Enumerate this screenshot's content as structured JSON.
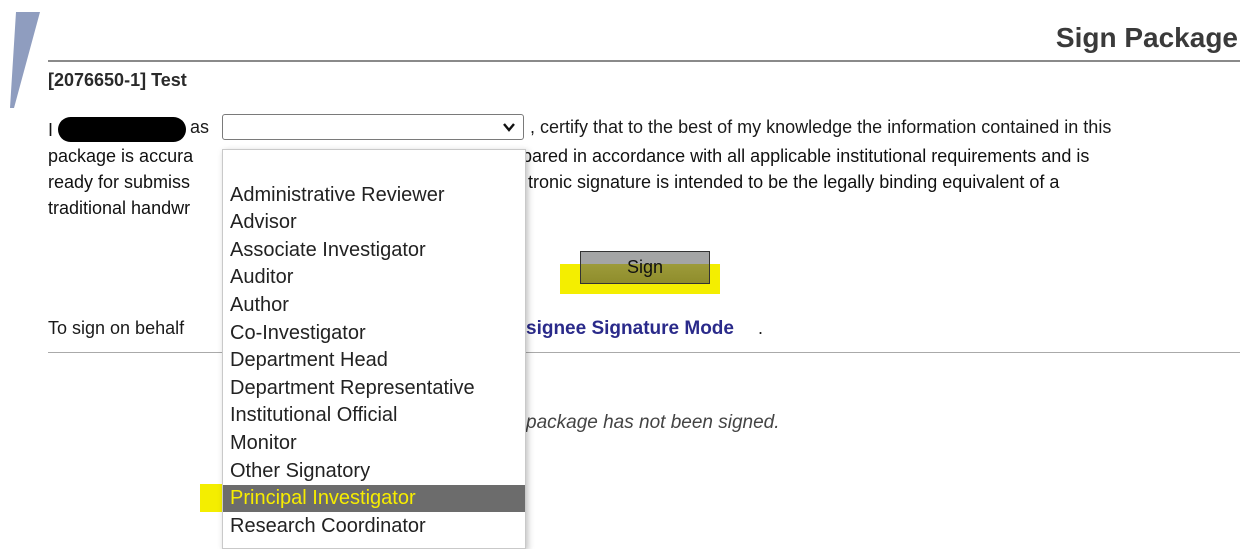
{
  "header": {
    "title": "Sign Package",
    "package_id": "[2076650-1] Test"
  },
  "certification": {
    "prefix": "I",
    "as_label": "as",
    "role_select_value": "",
    "line1_suffix": ", certify that to the best of my knowledge the information contained in this",
    "line2_left": "package is accura",
    "line2_right": "pared in accordance with all applicable institutional requirements and is",
    "line3_left": "ready for submiss",
    "line3_right": "tronic signature is intended to be the legally binding equivalent of a",
    "line4_left": "traditional handwr"
  },
  "actions": {
    "sign_label": "Sign"
  },
  "behalf": {
    "prefix": "To sign on behalf",
    "link": "signee Signature Mode",
    "suffix": "."
  },
  "status": {
    "message": "package has not been signed."
  },
  "role_options": [
    {
      "label": ""
    },
    {
      "label": "Administrative Reviewer"
    },
    {
      "label": "Advisor"
    },
    {
      "label": "Associate Investigator"
    },
    {
      "label": "Auditor"
    },
    {
      "label": "Author"
    },
    {
      "label": "Co-Investigator"
    },
    {
      "label": "Department Head"
    },
    {
      "label": "Department Representative"
    },
    {
      "label": "Institutional Official"
    },
    {
      "label": "Monitor"
    },
    {
      "label": "Other Signatory"
    },
    {
      "label": "Principal Investigator"
    },
    {
      "label": "Research Coordinator"
    }
  ],
  "highlighted_option": "Principal Investigator",
  "colors": {
    "highlight": "#f4ee00",
    "option_selected_bg": "#6c6c6c",
    "link": "#2a2a8a"
  }
}
